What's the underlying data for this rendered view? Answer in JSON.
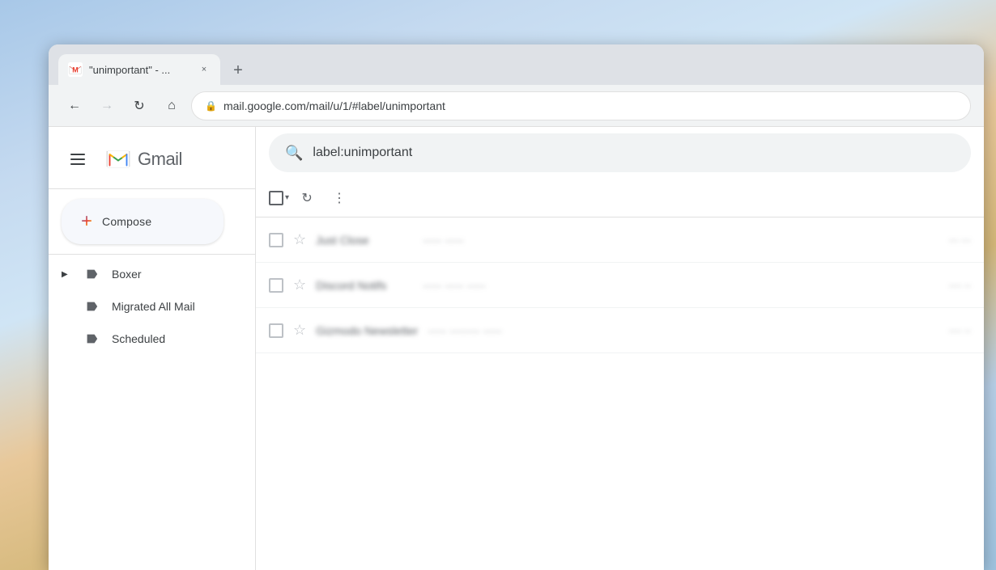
{
  "desktop": {
    "bg_description": "sky clouds desktop background"
  },
  "browser": {
    "tab": {
      "favicon": "M",
      "title": "\"unimportant\" - ...",
      "close_label": "×"
    },
    "new_tab_label": "+",
    "nav": {
      "back_icon": "←",
      "forward_icon": "→",
      "reload_icon": "↻",
      "home_icon": "⌂",
      "lock_icon": "🔒",
      "url": "mail.google.com/mail/u/1/#label/unimportant"
    }
  },
  "gmail": {
    "header": {
      "menu_icon": "menu",
      "logo_text": "Gmail"
    },
    "compose": {
      "plus_icon": "+",
      "label": "Compose"
    },
    "sidebar": {
      "items": [
        {
          "id": "boxer",
          "label": "Boxer",
          "has_expand": true
        },
        {
          "id": "migrated-all-mail",
          "label": "Migrated All Mail",
          "has_expand": false
        },
        {
          "id": "scheduled",
          "label": "Scheduled",
          "has_expand": false
        }
      ]
    },
    "search": {
      "placeholder": "label:unimportant",
      "icon": "🔍"
    },
    "toolbar": {
      "select_all_title": "Select all",
      "refresh_title": "Refresh",
      "more_title": "More"
    },
    "emails": [
      {
        "id": 1,
        "sender": "Just Close",
        "snippet": "...",
        "time": "...",
        "starred": false
      },
      {
        "id": 2,
        "sender": "Discord Notifs",
        "snippet": "...",
        "time": "...",
        "starred": false
      },
      {
        "id": 3,
        "sender": "Gizmodo Newsletter",
        "snippet": "...",
        "time": "...",
        "starred": false
      }
    ]
  }
}
